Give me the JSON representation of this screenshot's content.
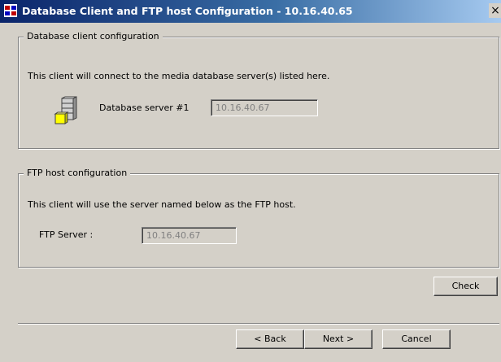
{
  "window": {
    "title": "Database Client and FTP host Configuration - 10.16.40.65",
    "close_label": "×"
  },
  "db_group": {
    "legend": "Database client configuration",
    "description": "This client will connect to the media database server(s) listed here.",
    "server_label": "Database server #1",
    "server_value": "10.16.40.67",
    "icon": "database-server-icon"
  },
  "ftp_group": {
    "legend": "FTP host configuration",
    "description": "This client will use the server named below as the FTP host.",
    "server_label": "FTP Server :",
    "server_value": "10.16.40.67"
  },
  "buttons": {
    "check": "Check",
    "back": "< Back",
    "next": "Next >",
    "cancel": "Cancel"
  }
}
